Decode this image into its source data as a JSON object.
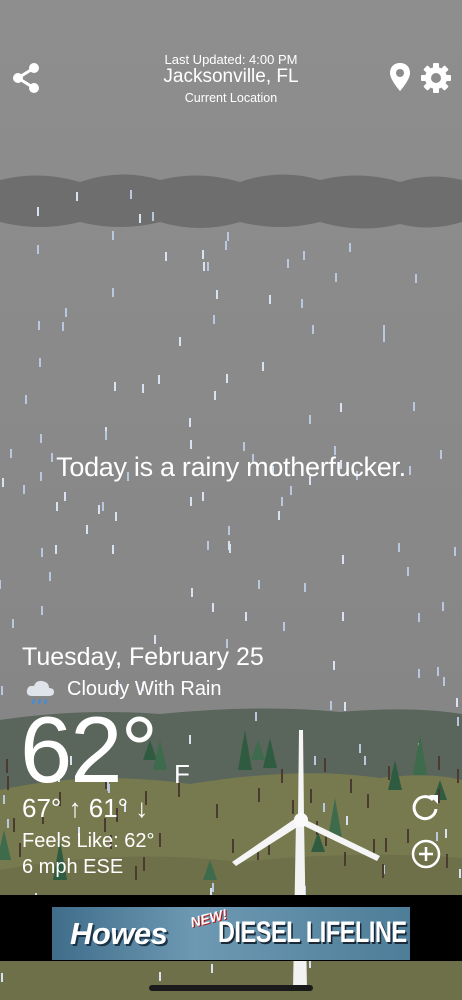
{
  "header": {
    "last_updated": "Last Updated: 4:00 PM",
    "city": "Jacksonville, FL",
    "location_label": "Current Location"
  },
  "tagline": "Today is a rainy motherfucker.",
  "forecast": {
    "date": "Tuesday, February 25",
    "condition": "Cloudy With Rain",
    "temperature": "62°",
    "unit": "F",
    "hi_lo": "67° ↑  61° ↓",
    "feels_like": "Feels Like: 62°",
    "wind": "6 mph ESE"
  },
  "ad": {
    "brand": "Howes",
    "badge": "NEW!",
    "product": "DIESEL LIFELINE"
  },
  "icons": {
    "share": "share-icon",
    "location": "location-pin-icon",
    "settings": "gear-icon",
    "weather": "cloud-rain-icon",
    "refresh": "refresh-icon",
    "add": "add-circle-icon"
  },
  "colors": {
    "sky": "#8a8a8a",
    "cloud_band": "#6c6c6c",
    "hills_far": "#58645a",
    "hills_near": "#797a4e",
    "ad_background": "#000000"
  }
}
